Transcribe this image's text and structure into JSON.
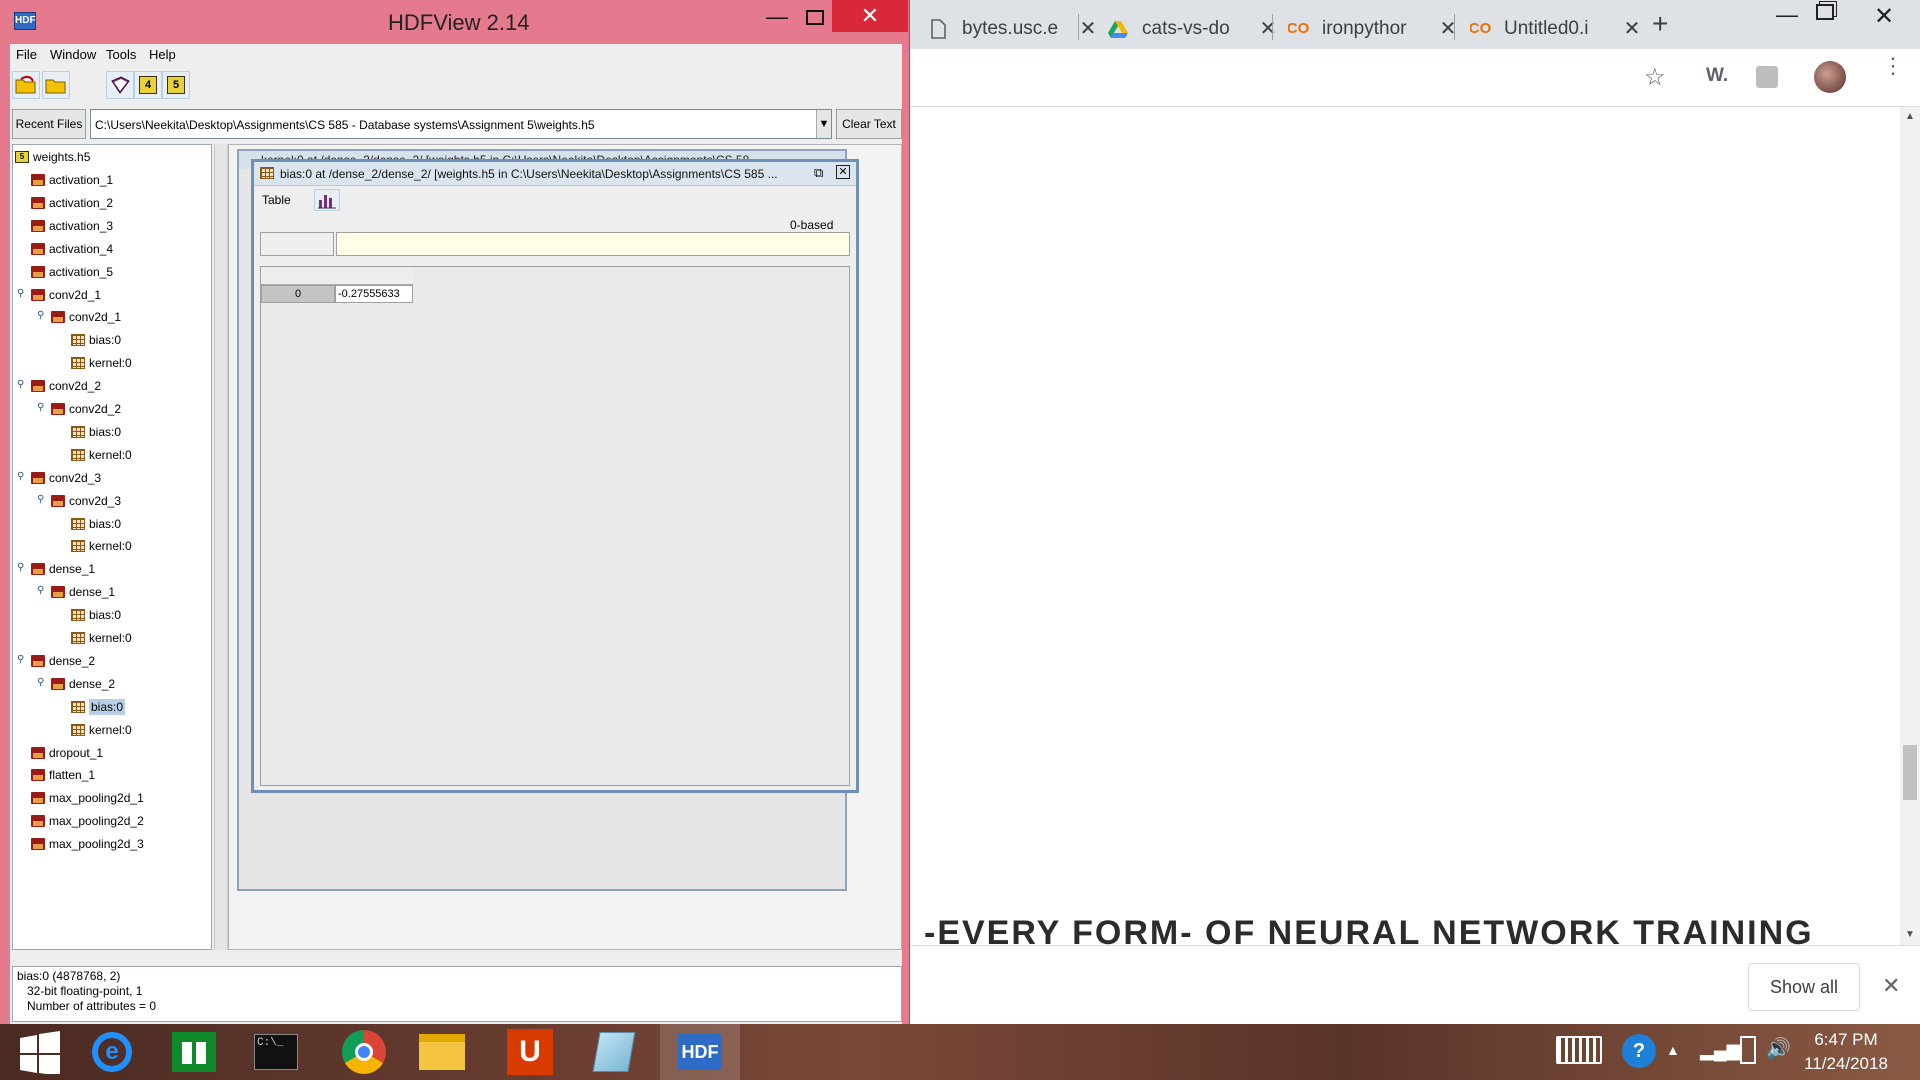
{
  "hdfview": {
    "title": "HDFView 2.14",
    "menu": [
      "File",
      "Window",
      "Tools",
      "Help"
    ],
    "recent_files_label": "Recent Files",
    "path": "C:\\Users\\Neekita\\Desktop\\Assignments\\CS 585 - Database systems\\Assignment 5\\weights.h5",
    "clear_text_label": "Clear Text",
    "tree_root": "weights.h5",
    "tree": [
      {
        "label": "activation_1",
        "kind": "group",
        "level": 1
      },
      {
        "label": "activation_2",
        "kind": "group",
        "level": 1
      },
      {
        "label": "activation_3",
        "kind": "group",
        "level": 1
      },
      {
        "label": "activation_4",
        "kind": "group",
        "level": 1
      },
      {
        "label": "activation_5",
        "kind": "group",
        "level": 1
      },
      {
        "label": "conv2d_1",
        "kind": "group",
        "level": 1,
        "expanded": true
      },
      {
        "label": "conv2d_1",
        "kind": "group",
        "level": 2,
        "expanded": true
      },
      {
        "label": "bias:0",
        "kind": "dataset",
        "level": 3
      },
      {
        "label": "kernel:0",
        "kind": "dataset",
        "level": 3
      },
      {
        "label": "conv2d_2",
        "kind": "group",
        "level": 1,
        "expanded": true
      },
      {
        "label": "conv2d_2",
        "kind": "group",
        "level": 2,
        "expanded": true
      },
      {
        "label": "bias:0",
        "kind": "dataset",
        "level": 3
      },
      {
        "label": "kernel:0",
        "kind": "dataset",
        "level": 3
      },
      {
        "label": "conv2d_3",
        "kind": "group",
        "level": 1,
        "expanded": true
      },
      {
        "label": "conv2d_3",
        "kind": "group",
        "level": 2,
        "expanded": true
      },
      {
        "label": "bias:0",
        "kind": "dataset",
        "level": 3
      },
      {
        "label": "kernel:0",
        "kind": "dataset",
        "level": 3
      },
      {
        "label": "dense_1",
        "kind": "group",
        "level": 1,
        "expanded": true
      },
      {
        "label": "dense_1",
        "kind": "group",
        "level": 2,
        "expanded": true
      },
      {
        "label": "bias:0",
        "kind": "dataset",
        "level": 3
      },
      {
        "label": "kernel:0",
        "kind": "dataset",
        "level": 3
      },
      {
        "label": "dense_2",
        "kind": "group",
        "level": 1,
        "expanded": true
      },
      {
        "label": "dense_2",
        "kind": "group",
        "level": 2,
        "expanded": true
      },
      {
        "label": "bias:0",
        "kind": "dataset",
        "level": 3,
        "selected": true
      },
      {
        "label": "kernel:0",
        "kind": "dataset",
        "level": 3
      },
      {
        "label": "dropout_1",
        "kind": "group",
        "level": 1
      },
      {
        "label": "flatten_1",
        "kind": "group",
        "level": 1
      },
      {
        "label": "max_pooling2d_1",
        "kind": "group",
        "level": 1
      },
      {
        "label": "max_pooling2d_2",
        "kind": "group",
        "level": 1
      },
      {
        "label": "max_pooling2d_3",
        "kind": "group",
        "level": 1
      }
    ],
    "back_window_title": "kernel:0  at  /dense_2/dense_2/  [weights.h5  in  C:\\Users\\Neekita\\Desktop\\Assignments\\CS 58...",
    "data_window": {
      "title": "bias:0  at  /dense_2/dense_2/  [weights.h5  in  C:\\Users\\Neekita\\Desktop\\Assignments\\CS 585 ...",
      "menu_table": "Table",
      "index_base": "0-based",
      "row_index": "0",
      "value": "-0.27555633"
    },
    "info": {
      "line1": "bias:0 (4878768, 2)",
      "line2": "32-bit floating-point,    1",
      "line3": "Number of attributes = 0"
    }
  },
  "chrome": {
    "tabs": [
      {
        "title": "bytes.usc.e",
        "icon": "page-icon"
      },
      {
        "title": "cats-vs-do",
        "icon": "google-drive-icon"
      },
      {
        "title": "ironpythor",
        "icon": "colab-icon"
      },
      {
        "title": "Untitled0.i",
        "icon": "colab-icon"
      }
    ],
    "headline": "-EVERY FORM- OF NEURAL NETWORK TRAINING",
    "show_all_label": "Show all",
    "extension_label": "W."
  },
  "taskbar": {
    "time": "6:47 PM",
    "date": "11/24/2018",
    "apps": [
      "windows-start",
      "internet-explorer",
      "store",
      "command-prompt",
      "chrome",
      "file-explorer",
      "office",
      "notepad",
      "hdfview"
    ]
  },
  "colors": {
    "hdf_frame": "#e57a8e",
    "selection": "#b8cfe5",
    "accent_blue": "#6f8fb4"
  }
}
